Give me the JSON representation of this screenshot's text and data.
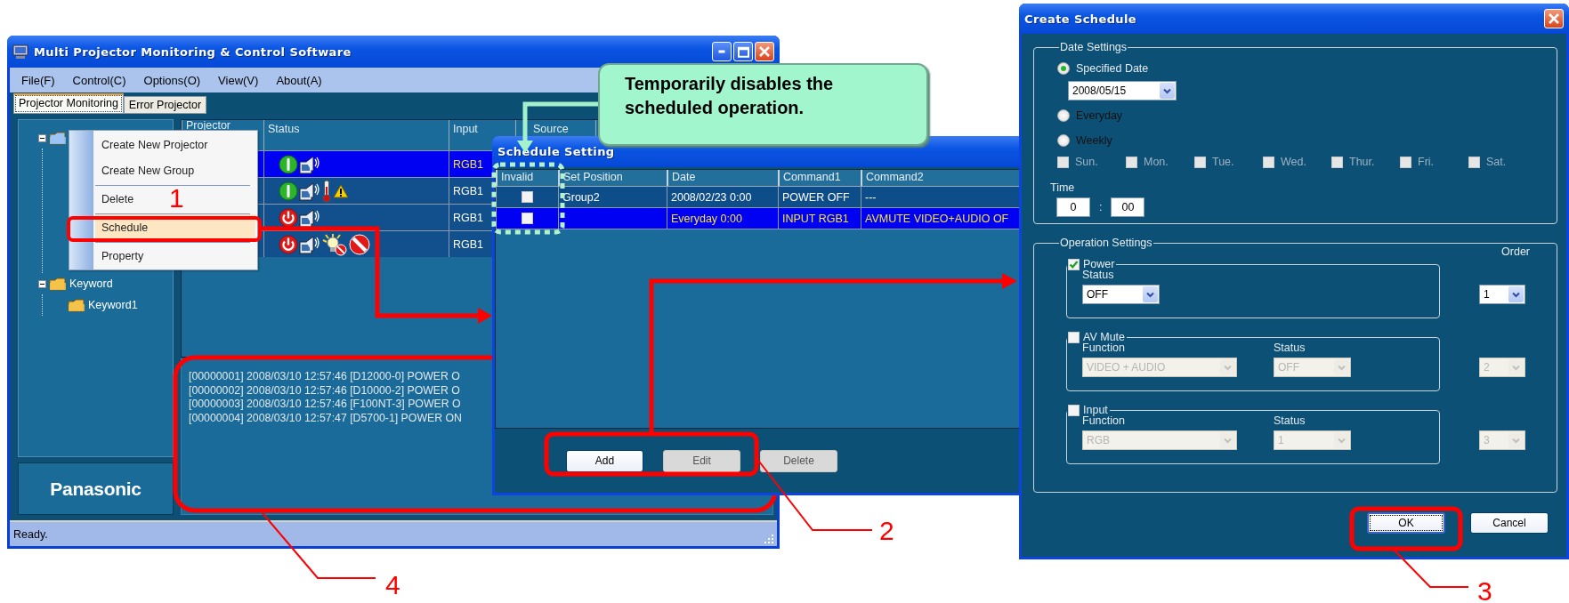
{
  "main_window": {
    "title": "Multi Projector Monitoring & Control Software",
    "menu": [
      "File(F)",
      "Control(C)",
      "Options(O)",
      "View(V)",
      "About(A)"
    ],
    "tabs": [
      {
        "label": "Projector Monitoring",
        "selected": true
      },
      {
        "label": "Error Projector",
        "selected": false
      }
    ],
    "tree": [
      {
        "expanded": true
      },
      {
        "label": "Keyword",
        "expanded": true,
        "children": [
          {
            "label": "Keyword1"
          }
        ]
      }
    ],
    "logo": "Panasonic",
    "projector_table": {
      "columns": [
        "Projector",
        "Status",
        "Input",
        "Source"
      ],
      "rows": [
        {
          "selected": true,
          "power_on": true,
          "temperature_warning": false,
          "lamp_off": false,
          "error": false,
          "input": "RGB1"
        },
        {
          "selected": false,
          "power_on": true,
          "temperature_warning": true,
          "lamp_off": false,
          "error": false,
          "input": "RGB1"
        },
        {
          "selected": false,
          "power_on": false,
          "temperature_warning": false,
          "lamp_off": false,
          "error": false,
          "input": "RGB1"
        },
        {
          "selected": false,
          "power_on": false,
          "temperature_warning": false,
          "lamp_off": true,
          "error": true,
          "input": "RGB1"
        }
      ]
    },
    "log": [
      "[00000001] 2008/03/10 12:57:46 [D12000-0] POWER O",
      "[00000002] 2008/03/10 12:57:46 [D10000-2] POWER O",
      "[00000003] 2008/03/10 12:57:46 [F100NT-3] POWER O",
      "[00000004] 2008/03/10 12:57:47 [D5700-1] POWER ON"
    ],
    "status_bar": "Ready.",
    "context_menu": [
      {
        "kind": "item",
        "label": "Create New Projector",
        "selected": false
      },
      {
        "kind": "item",
        "label": "Create New Group",
        "selected": false
      },
      {
        "kind": "separator"
      },
      {
        "kind": "item",
        "label": "Delete",
        "selected": false
      },
      {
        "kind": "separator"
      },
      {
        "kind": "item",
        "label": "Schedule",
        "selected": true
      },
      {
        "kind": "separator"
      },
      {
        "kind": "item",
        "label": "Property",
        "selected": false
      }
    ]
  },
  "schedule_dialog": {
    "title": "Schedule Setting",
    "columns": [
      "Invalid",
      "Set Position",
      "Date",
      "Command1",
      "Command2"
    ],
    "rows": [
      {
        "selected": false,
        "invalid": false,
        "set_position": "Group2",
        "date": "2008/02/23 0:00",
        "command1": "POWER OFF",
        "command2": "---"
      },
      {
        "selected": true,
        "invalid": false,
        "date": "Everyday 0:00",
        "command1": "INPUT RGB1",
        "command2": "AVMUTE VIDEO+AUDIO OF"
      }
    ],
    "buttons": [
      {
        "label": "Add",
        "disabled": false
      },
      {
        "label": "Edit",
        "disabled": true
      },
      {
        "label": "Delete",
        "disabled": true
      }
    ]
  },
  "create_dialog": {
    "title": "Create Schedule",
    "date_settings": {
      "title": "Date Settings",
      "options": [
        {
          "label": "Specified Date",
          "selected": true
        },
        {
          "label": "Everyday",
          "selected": false
        },
        {
          "label": "Weekly",
          "selected": false
        }
      ],
      "date": "2008/05/15",
      "days": [
        {
          "label": "Sun.",
          "checked": false
        },
        {
          "label": "Mon.",
          "checked": false
        },
        {
          "label": "Tue.",
          "checked": false
        },
        {
          "label": "Wed.",
          "checked": false
        },
        {
          "label": "Thur.",
          "checked": false
        },
        {
          "label": "Fri.",
          "checked": false
        },
        {
          "label": "Sat.",
          "checked": false
        }
      ],
      "time_label": "Time",
      "hour": "0",
      "separator": ":",
      "minute": "00"
    },
    "operation_settings": {
      "title": "Operation Settings",
      "order_label": "Order",
      "operations": [
        {
          "label": "Power",
          "checked": true,
          "fields": [
            {
              "label": "Status",
              "value": "OFF"
            }
          ],
          "order": "1"
        },
        {
          "label": "AV Mute",
          "checked": false,
          "fields": [
            {
              "label": "Function",
              "value": "VIDEO + AUDIO"
            },
            {
              "label": "Status",
              "value": "OFF"
            }
          ],
          "order": "2"
        },
        {
          "label": "Input",
          "checked": false,
          "fields": [
            {
              "label": "Function",
              "value": "RGB"
            },
            {
              "label": "Status",
              "value": "1"
            }
          ],
          "order": "3"
        }
      ]
    },
    "buttons": [
      {
        "label": "OK",
        "focused": true
      },
      {
        "label": "Cancel",
        "focused": false
      }
    ]
  },
  "annotations": {
    "callout": "Temporarily disables the scheduled operation.",
    "steps": [
      "1",
      "2",
      "3",
      "4"
    ]
  }
}
